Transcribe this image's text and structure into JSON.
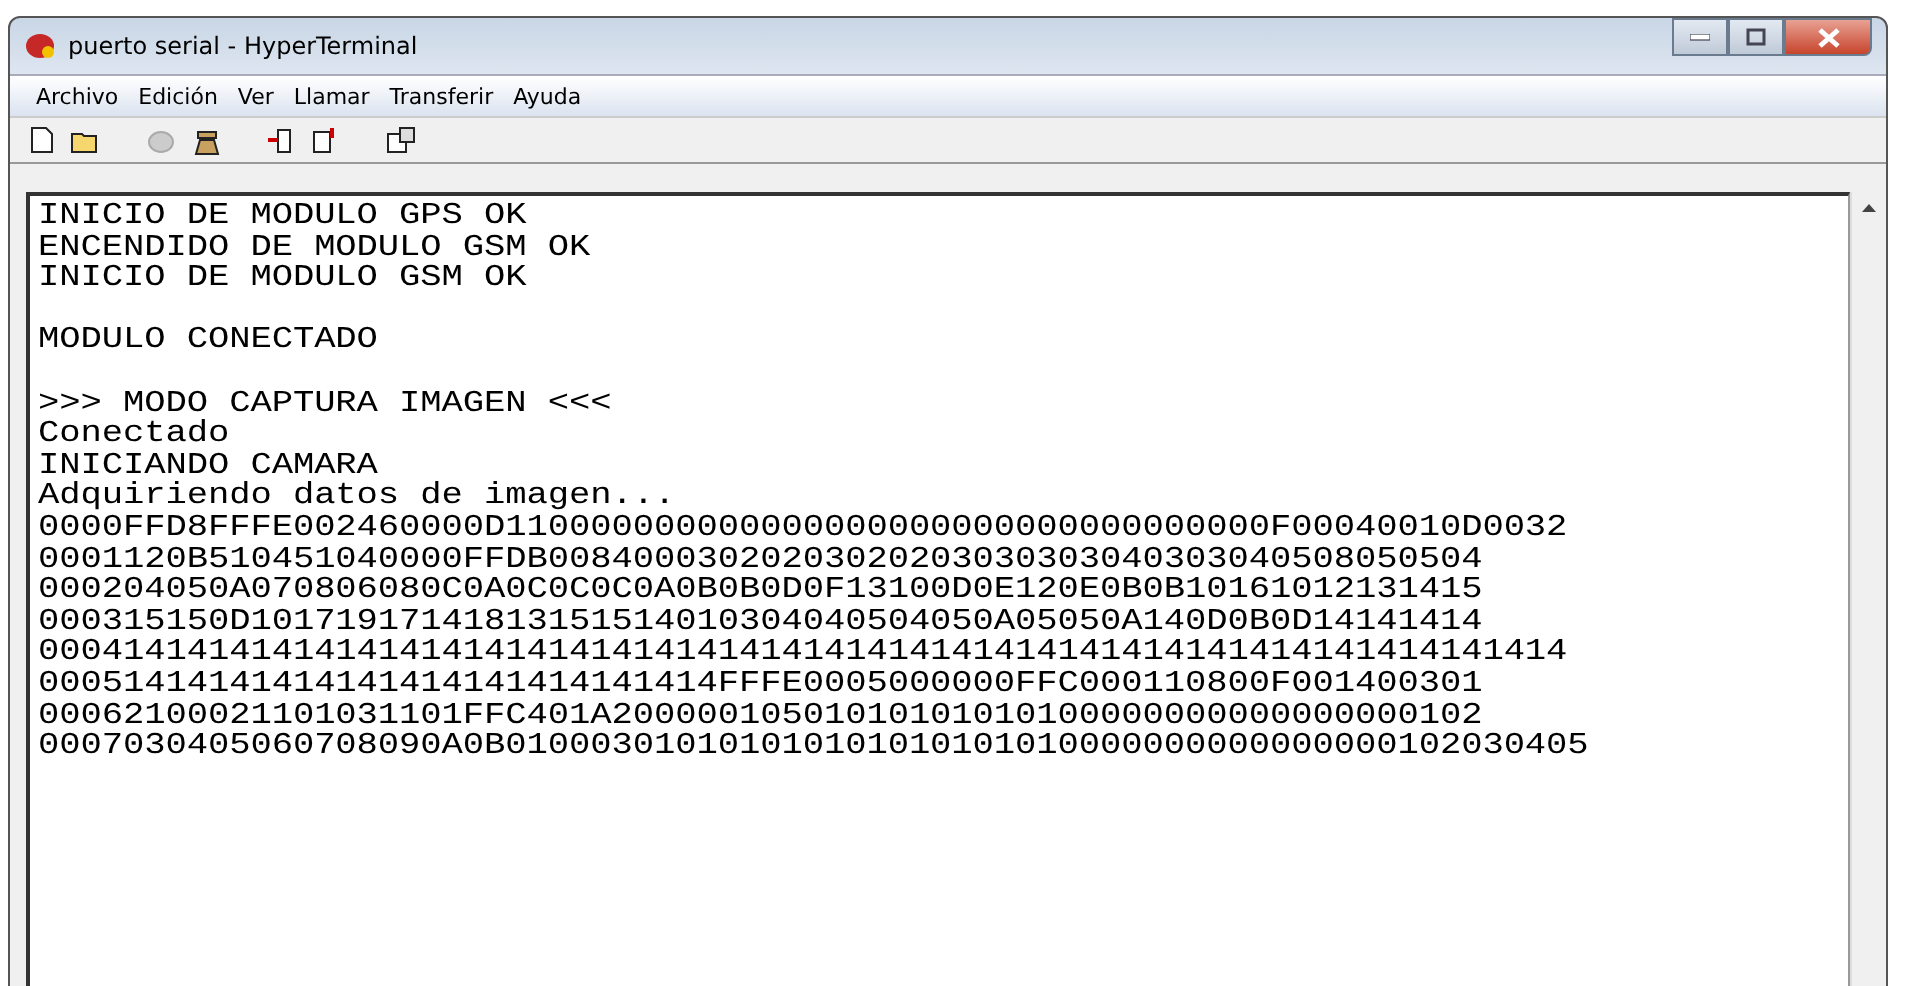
{
  "window": {
    "title": "puerto serial - HyperTerminal"
  },
  "menu": [
    "Archivo",
    "Edición",
    "Ver",
    "Llamar",
    "Transferir",
    "Ayuda"
  ],
  "toolbar": [
    {
      "kind": "new",
      "disabled": false
    },
    {
      "kind": "open",
      "disabled": false
    },
    {
      "kind": "disconnect",
      "disabled": true
    },
    {
      "kind": "dial",
      "disabled": false
    },
    {
      "kind": "send",
      "disabled": false
    },
    {
      "kind": "receive",
      "disabled": false
    },
    {
      "kind": "properties",
      "disabled": false
    }
  ],
  "terminal": {
    "blocks": [
      [
        "INICIO DE MODULO GPS OK",
        "ENCENDIDO DE MODULO GSM OK",
        "INICIO DE MODULO GSM OK"
      ],
      [
        "MODULO CONECTADO"
      ],
      [
        ">>> MODO CAPTURA IMAGEN <<<",
        "Conectado",
        "INICIANDO CAMARA",
        "Adquiriendo datos de imagen...",
        "0000FFD8FFFE002460000D110000000000000000000000000000000000F00040010D0032",
        "0001120B510451040000FFDB00840003020203020203030303040303040508050504",
        "000204050A070806080C0A0C0C0C0A0B0B0D0F13100D0E120E0B0B10161012131415",
        "000315150D10171917141813151514010304040504050A05050A140D0B0D14141414",
        "000414141414141414141414141414141414141414141414141414141414141414141414",
        "00051414141414141414141414141414FFFE0005000000FFC000110800F001400301",
        "00062100021101031101FFC401A20000010501010101010100000000000000000102",
        "0007030405060708090A0B010003010101010101010101010000000000000000102030405"
      ]
    ]
  }
}
